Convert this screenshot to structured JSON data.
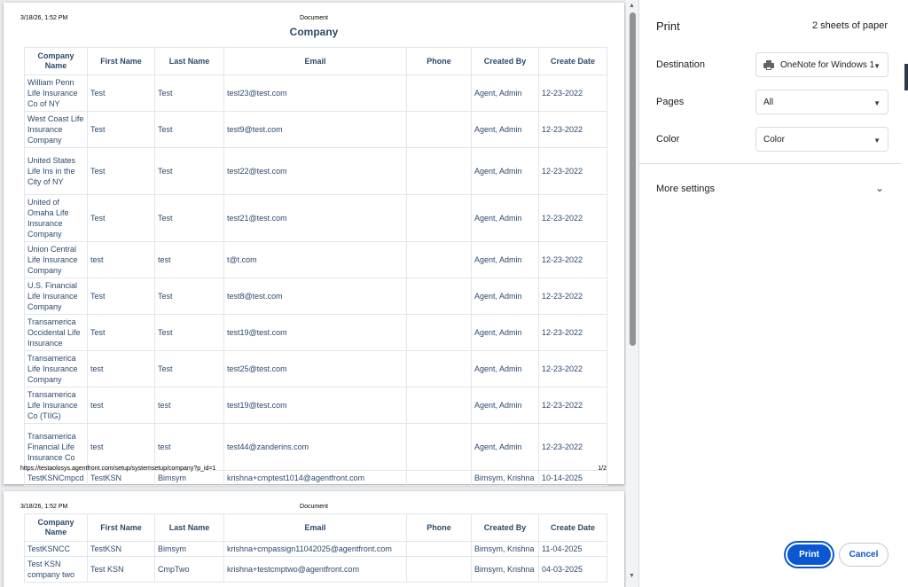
{
  "preview": {
    "page1": {
      "header_date": "3/18/26, 1:52 PM",
      "header_doc": "Document",
      "title": "Company",
      "footer_url": "https://testaolosys.agentfront.com/setup/systemsetup/company?p_id=1",
      "footer_page": "1/2"
    },
    "page2": {
      "header_date": "3/18/26, 1:52 PM",
      "header_doc": "Document"
    },
    "columns": [
      "Company Name",
      "First Name",
      "Last Name",
      "Email",
      "Phone",
      "Created By",
      "Create Date"
    ],
    "rows_page1": [
      [
        "William Penn Life Insurance Co of NY",
        "Test",
        "Test",
        "test23@test.com",
        "",
        "Agent, Admin",
        "12-23-2022"
      ],
      [
        "West Coast Life Insurance Company",
        "Test",
        "Test",
        "test9@test.com",
        "",
        "Agent, Admin",
        "12-23-2022"
      ],
      [
        "United States Life Ins in the City of NY",
        "Test",
        "Test",
        "test22@test.com",
        "",
        "Agent, Admin",
        "12-23-2022"
      ],
      [
        "United of Omaha Life Insurance Company",
        "Test",
        "Test",
        "test21@test.com",
        "",
        "Agent, Admin",
        "12-23-2022"
      ],
      [
        "Union Central Life Insurance Company",
        "test",
        "test",
        "t@t.com",
        "",
        "Agent, Admin",
        "12-23-2022"
      ],
      [
        "U.S. Financial Life Insurance Company",
        "Test",
        "Test",
        "test8@test.com",
        "",
        "Agent, Admin",
        "12-23-2022"
      ],
      [
        "Transamerica Occidental Life Insurance",
        "Test",
        "Test",
        "test19@test.com",
        "",
        "Agent, Admin",
        "12-23-2022"
      ],
      [
        "Transamerica Life Insurance Company",
        "test",
        "Test",
        "test25@test.com",
        "",
        "Agent, Admin",
        "12-23-2022"
      ],
      [
        "Transamerica Life Insurance Co (TIIG)",
        "test",
        "test",
        "test19@test.com",
        "",
        "Agent, Admin",
        "12-23-2022"
      ],
      [
        "Transamerica Financial Life Insurance Co",
        "test",
        "test",
        "test44@zanderins.com",
        "",
        "Agent, Admin",
        "12-23-2022"
      ],
      [
        "TestKSNCmpcd",
        "TestKSN",
        "Bimsym",
        "krishna+cmptest1014@agentfront.com",
        "",
        "Bimsym, Krishna",
        "10-14-2025"
      ]
    ],
    "rows_page2": [
      [
        "TestKSNCC",
        "TestKSN",
        "Bimsym",
        "krishna+cmpassign11042025@agentfront.com",
        "",
        "Bimsym, Krishna",
        "11-04-2025"
      ],
      [
        "Test KSN company two",
        "Test KSN",
        "CmpTwo",
        "krishna+testcmptwo@agentfront.com",
        "",
        "Bimsym, Krishna",
        "04-03-2025"
      ]
    ]
  },
  "panel": {
    "title": "Print",
    "sheets": "2 sheets of paper",
    "destination_label": "Destination",
    "destination_value": "OneNote for Windows 1",
    "pages_label": "Pages",
    "pages_value": "All",
    "color_label": "Color",
    "color_value": "Color",
    "more_settings": "More settings",
    "print_button": "Print",
    "cancel_button": "Cancel"
  },
  "icons": {
    "printer": "printer-icon",
    "dropdown": "chevron-down-icon",
    "expand": "chevron-down-icon"
  },
  "colors": {
    "accent": "#0b57d0",
    "table_text": "#2c4a6b"
  }
}
